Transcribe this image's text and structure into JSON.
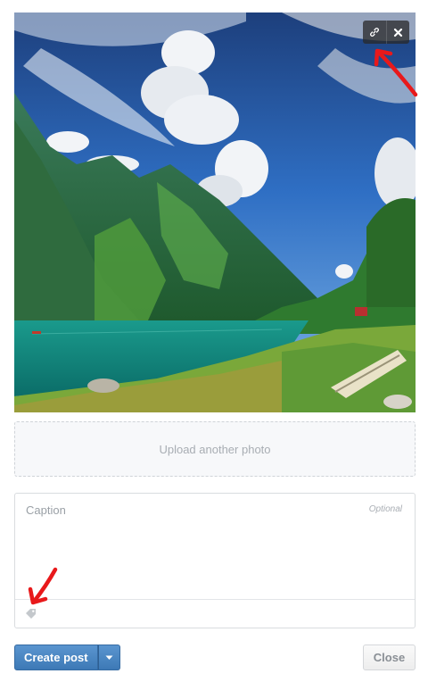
{
  "photo": {
    "alt": "Landscape photo",
    "link_icon": "link-icon",
    "remove_icon": "close-icon"
  },
  "upload": {
    "label": "Upload another photo"
  },
  "caption": {
    "placeholder": "Caption",
    "optional_label": "Optional",
    "tag_icon": "tag-icon"
  },
  "actions": {
    "create_label": "Create post",
    "caret_icon": "caret-down-icon",
    "close_label": "Close"
  },
  "colors": {
    "primary": "#3d79b6",
    "annotation_arrow": "#e8191b"
  }
}
